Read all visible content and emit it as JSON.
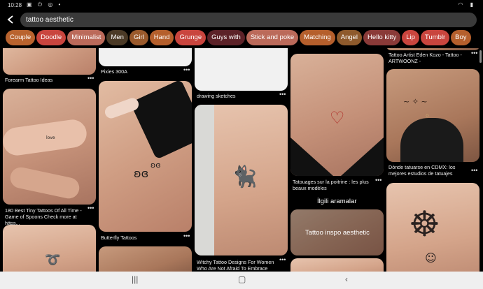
{
  "status": {
    "time": "10:28"
  },
  "search": {
    "query": "tattoo aesthetic"
  },
  "chips": [
    {
      "label": "Couple",
      "color": "#b9632e"
    },
    {
      "label": "Doodle",
      "color": "#c9453e"
    },
    {
      "label": "Minimalist",
      "color": "#bb6a5a"
    },
    {
      "label": "Men",
      "color": "#4b3a26"
    },
    {
      "label": "Girl",
      "color": "#9a5a2c"
    },
    {
      "label": "Hand",
      "color": "#b55f2c"
    },
    {
      "label": "Grunge",
      "color": "#c9453e"
    },
    {
      "label": "Guys with",
      "color": "#5c2228"
    },
    {
      "label": "Stick and poke",
      "color": "#bb6a5a"
    },
    {
      "label": "Matching",
      "color": "#b55f2c"
    },
    {
      "label": "Angel",
      "color": "#8e5a2c"
    },
    {
      "label": "Hello kitty",
      "color": "#8a3a38"
    },
    {
      "label": "Lip",
      "color": "#c9453e"
    },
    {
      "label": "Tumblr",
      "color": "#c9453e"
    },
    {
      "label": "Boy",
      "color": "#b55f2c"
    }
  ],
  "pins": {
    "forearm": {
      "title": "Forearm Tattoo Ideas"
    },
    "best": {
      "title": "180 Best Tiny Tattoos Of All Time - Game of Spoons Check more at https..."
    },
    "pixies": {
      "title": "Pixies 300A"
    },
    "butterfly": {
      "title": "Butterfly Tattoos"
    },
    "drawing": {
      "title": "drawing sketches"
    },
    "witchy": {
      "title": "Witchy Tattoo Designs For Women Who Are Not Afraid To Embrace Thei..."
    },
    "poitrine": {
      "title": "Tatouages sur la poitrine : les plus beaux modèles"
    },
    "eden": {
      "title": "Tattoo Artist Eden Kozo - Tattoo - ARTWOONZ -"
    },
    "donde": {
      "title": "Dónde tatuarse en CDMX: los mejores estudios de tatuajes"
    }
  },
  "related": {
    "heading": "İlgili aramalar",
    "card": "Tattoo inspo aesthetic"
  },
  "icons": {
    "back": "arrow-left",
    "more": "more-horizontal",
    "nav": [
      "recents",
      "home",
      "back"
    ]
  }
}
